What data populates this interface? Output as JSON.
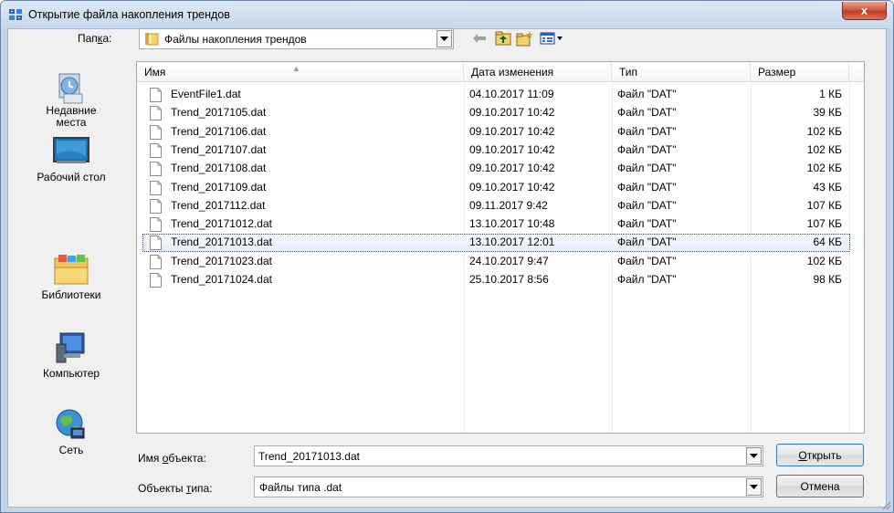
{
  "window": {
    "title": "Открытие файла накопления трендов",
    "close_glyph": "x"
  },
  "lookin": {
    "label_pre": "Пап",
    "label_u": "к",
    "label_post": "а:",
    "value": "Файлы накопления трендов"
  },
  "toolbar": {
    "back_icon": "back-arrow-icon",
    "up_icon": "folder-up-icon",
    "new_folder_icon": "new-folder-icon",
    "view_icon": "view-menu-icon"
  },
  "places": [
    {
      "label1": "Недавние",
      "label2": "места",
      "icon": "recent-places-icon"
    },
    {
      "label1": "Рабочий стол",
      "label2": "",
      "icon": "desktop-icon"
    },
    {
      "label1": "Библиотеки",
      "label2": "",
      "icon": "libraries-icon"
    },
    {
      "label1": "Компьютер",
      "label2": "",
      "icon": "computer-icon"
    },
    {
      "label1": "Сеть",
      "label2": "",
      "icon": "network-icon"
    }
  ],
  "columns": {
    "name": "Имя",
    "date": "Дата изменения",
    "type": "Тип",
    "size": "Размер"
  },
  "files": [
    {
      "name": "EventFile1.dat",
      "date": "04.10.2017 11:09",
      "type": "Файл \"DAT\"",
      "size": "1 КБ"
    },
    {
      "name": "Trend_2017105.dat",
      "date": "09.10.2017 10:42",
      "type": "Файл \"DAT\"",
      "size": "39 КБ"
    },
    {
      "name": "Trend_2017106.dat",
      "date": "09.10.2017 10:42",
      "type": "Файл \"DAT\"",
      "size": "102 КБ"
    },
    {
      "name": "Trend_2017107.dat",
      "date": "09.10.2017 10:42",
      "type": "Файл \"DAT\"",
      "size": "102 КБ"
    },
    {
      "name": "Trend_2017108.dat",
      "date": "09.10.2017 10:42",
      "type": "Файл \"DAT\"",
      "size": "102 КБ"
    },
    {
      "name": "Trend_2017109.dat",
      "date": "09.10.2017 10:42",
      "type": "Файл \"DAT\"",
      "size": "43 КБ"
    },
    {
      "name": "Trend_2017112.dat",
      "date": "09.11.2017 9:42",
      "type": "Файл \"DAT\"",
      "size": "107 КБ"
    },
    {
      "name": "Trend_20171012.dat",
      "date": "13.10.2017 10:48",
      "type": "Файл \"DAT\"",
      "size": "107 КБ"
    },
    {
      "name": "Trend_20171013.dat",
      "date": "13.10.2017 12:01",
      "type": "Файл \"DAT\"",
      "size": "64 КБ"
    },
    {
      "name": "Trend_20171023.dat",
      "date": "24.10.2017 9:47",
      "type": "Файл \"DAT\"",
      "size": "102 КБ"
    },
    {
      "name": "Trend_20171024.dat",
      "date": "25.10.2017 8:56",
      "type": "Файл \"DAT\"",
      "size": "98 КБ"
    }
  ],
  "selected_file": "Trend_20171013.dat",
  "filename": {
    "label_pre": "Имя ",
    "label_u": "о",
    "label_post": "бъекта:",
    "value": "Trend_20171013.dat"
  },
  "filetype": {
    "label_pre": "Объекты ",
    "label_u": "т",
    "label_post": "ипа:",
    "value": "Файлы типа .dat"
  },
  "buttons": {
    "open_u": "О",
    "open_rest": "ткрыть",
    "cancel": "Отмена"
  },
  "colors": {
    "title_bg": "#c6d6ea",
    "close_red": "#c23b1f",
    "selection_border": "#4b4b4b",
    "default_button": "#3c7fb1"
  }
}
